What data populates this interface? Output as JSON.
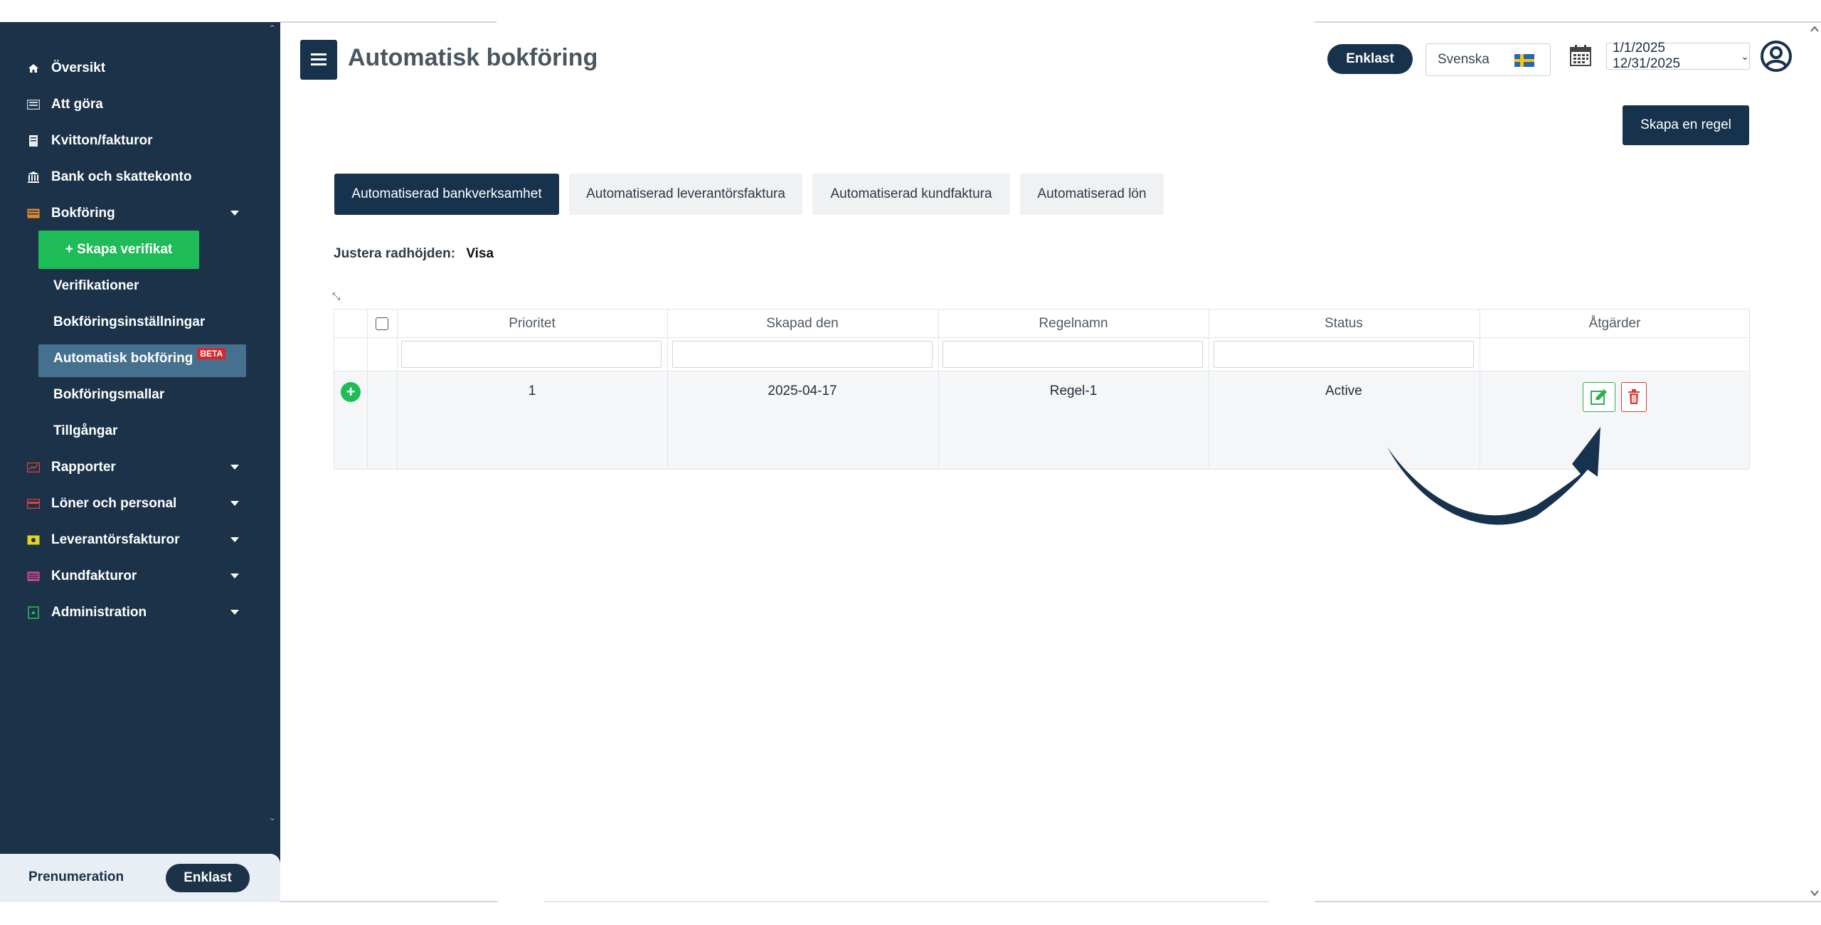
{
  "page": {
    "title": "Automatisk bokföring"
  },
  "header": {
    "mode_label": "Enklast",
    "language": "Svenska",
    "date_range": "1/1/2025 12/31/2025",
    "create_rule_label": "Skapa en regel"
  },
  "sidebar": {
    "items": [
      {
        "label": "Översikt",
        "icon": "home-icon"
      },
      {
        "label": "Att göra",
        "icon": "todo-icon"
      },
      {
        "label": "Kvitton/fakturor",
        "icon": "receipt-icon"
      },
      {
        "label": "Bank och skattekonto",
        "icon": "bank-icon"
      },
      {
        "label": "Bokföring",
        "icon": "ledger-icon"
      },
      {
        "label": "Rapporter",
        "icon": "chart-icon"
      },
      {
        "label": "Löner och personal",
        "icon": "payroll-icon"
      },
      {
        "label": "Leverantörsfakturor",
        "icon": "supplier-invoice-icon"
      },
      {
        "label": "Kundfakturor",
        "icon": "customer-invoice-icon"
      },
      {
        "label": "Administration",
        "icon": "admin-icon"
      }
    ],
    "create_voucher_label": "+ Skapa verifikat",
    "sub_items": [
      {
        "label": "Verifikationer"
      },
      {
        "label": "Bokföringsinställningar"
      },
      {
        "label": "Automatisk bokföring"
      },
      {
        "label": "Bokföringsmallar"
      },
      {
        "label": "Tillgångar"
      }
    ],
    "beta_badge": "BETA",
    "subscription_label": "Prenumeration",
    "plan_label": "Enklast"
  },
  "tabs": [
    {
      "label": "Automatiserad bankverksamhet",
      "active": true
    },
    {
      "label": "Automatiserad leverantörsfaktura",
      "active": false
    },
    {
      "label": "Automatiserad kundfaktura",
      "active": false
    },
    {
      "label": "Automatiserad lön",
      "active": false
    }
  ],
  "row_height": {
    "label": "Justera radhöjden:",
    "value": "Visa"
  },
  "table": {
    "columns": [
      "Prioritet",
      "Skapad den",
      "Regelnamn",
      "Status",
      "Åtgärder"
    ],
    "rows": [
      {
        "prioritet": "1",
        "skapad_den": "2025-04-17",
        "regelnamn": "Regel-1",
        "status": "Active"
      }
    ]
  },
  "colors": {
    "sidebar_bg": "#1b3249",
    "primary": "#17324d",
    "success": "#1fbb56",
    "danger": "#d23b3b"
  }
}
